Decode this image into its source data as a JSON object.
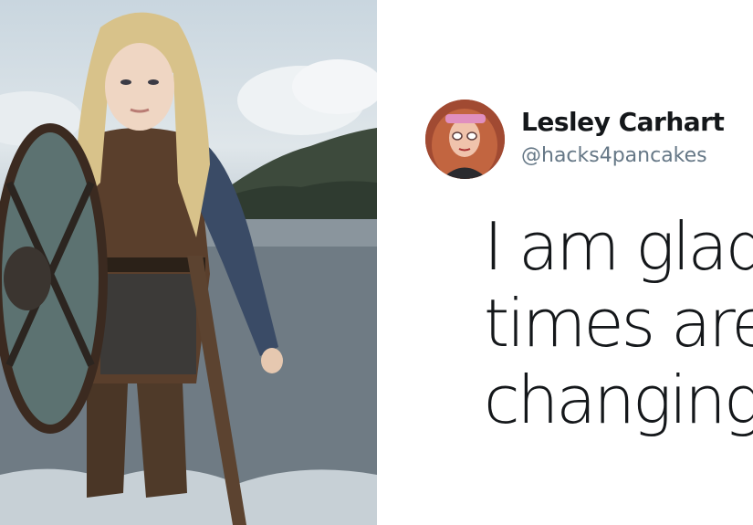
{
  "tweet": {
    "display_name": "Lesley Carhart",
    "handle": "@hacks4pancakes",
    "text_lines": [
      "I am glad",
      "times are",
      "changing"
    ]
  },
  "photo": {
    "subject": "shield-maiden-in-water"
  },
  "colors": {
    "name": "#14171a",
    "handle": "#657786",
    "text": "#14171a"
  }
}
